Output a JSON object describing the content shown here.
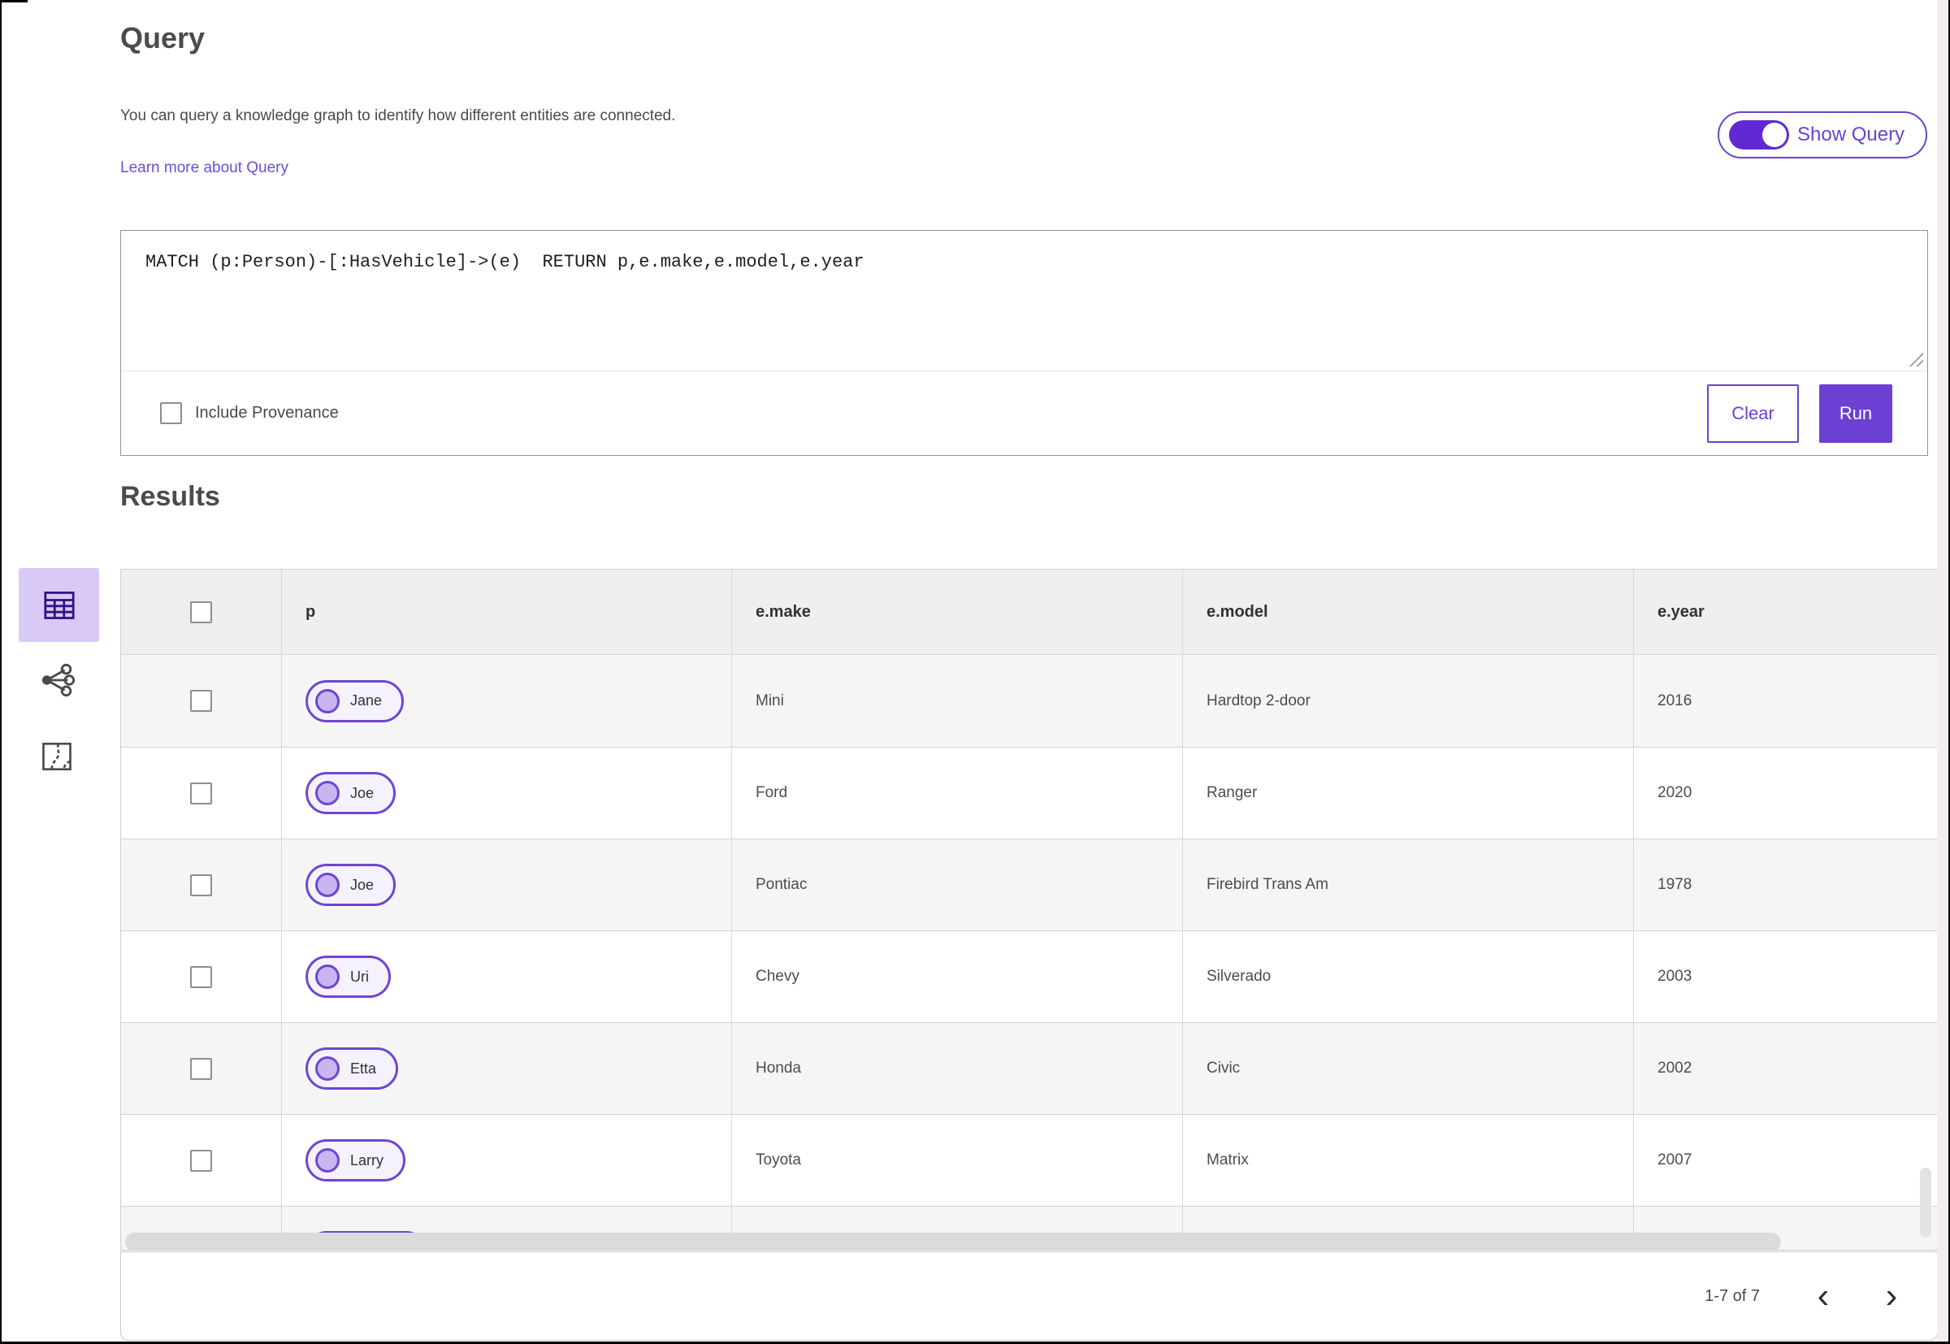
{
  "header": {
    "title": "Query",
    "description": "You can query a knowledge graph to identify how different entities are connected.",
    "learn_more_label": "Learn more about Query",
    "show_query_label": "Show Query",
    "show_query_state": "on"
  },
  "query": {
    "text": "MATCH (p:Person)-[:HasVehicle]->(e)  RETURN p,e.make,e.model,e.year",
    "include_provenance_label": "Include Provenance",
    "include_provenance_checked": false,
    "clear_label": "Clear",
    "run_label": "Run"
  },
  "results": {
    "title": "Results"
  },
  "view_switcher": {
    "items": [
      {
        "icon": "table-view-icon",
        "selected": true
      },
      {
        "icon": "link-chart-view-icon",
        "selected": false
      },
      {
        "icon": "map-view-icon",
        "selected": false
      }
    ]
  },
  "table": {
    "columns": {
      "c0": "",
      "c1": "p",
      "c2": "e.make",
      "c3": "e.model",
      "c4": "e.year"
    },
    "rows": [
      {
        "p": "Jane",
        "make": "Mini",
        "model": "Hardtop 2-door",
        "year": "2016"
      },
      {
        "p": "Joe",
        "make": "Ford",
        "model": "Ranger",
        "year": "2020"
      },
      {
        "p": "Joe",
        "make": "Pontiac",
        "model": "Firebird Trans Am",
        "year": "1978"
      },
      {
        "p": "Uri",
        "make": "Chevy",
        "model": "Silverado",
        "year": "2003"
      },
      {
        "p": "Etta",
        "make": "Honda",
        "model": "Civic",
        "year": "2002"
      },
      {
        "p": "Larry",
        "make": "Toyota",
        "model": "Matrix",
        "year": "2007"
      },
      {
        "p": "",
        "make": "",
        "model": "",
        "year": "",
        "partial": true
      }
    ]
  },
  "pagination": {
    "range_label": "1-7 of 7",
    "prev_icon": "‹",
    "next_icon": "›"
  },
  "colors": {
    "accent_purple": "#6b40d2",
    "toggle_purple": "#6029d4",
    "pill_border": "#6e45d3",
    "pill_fill": "#f5f2fd",
    "pill_dot": "#c9b5f0",
    "selected_view_bg": "#dac9f7",
    "header_row_bg": "#f0eff0",
    "alt_row_bg": "#f6f5f6",
    "text_dark": "#4a4a4a"
  }
}
